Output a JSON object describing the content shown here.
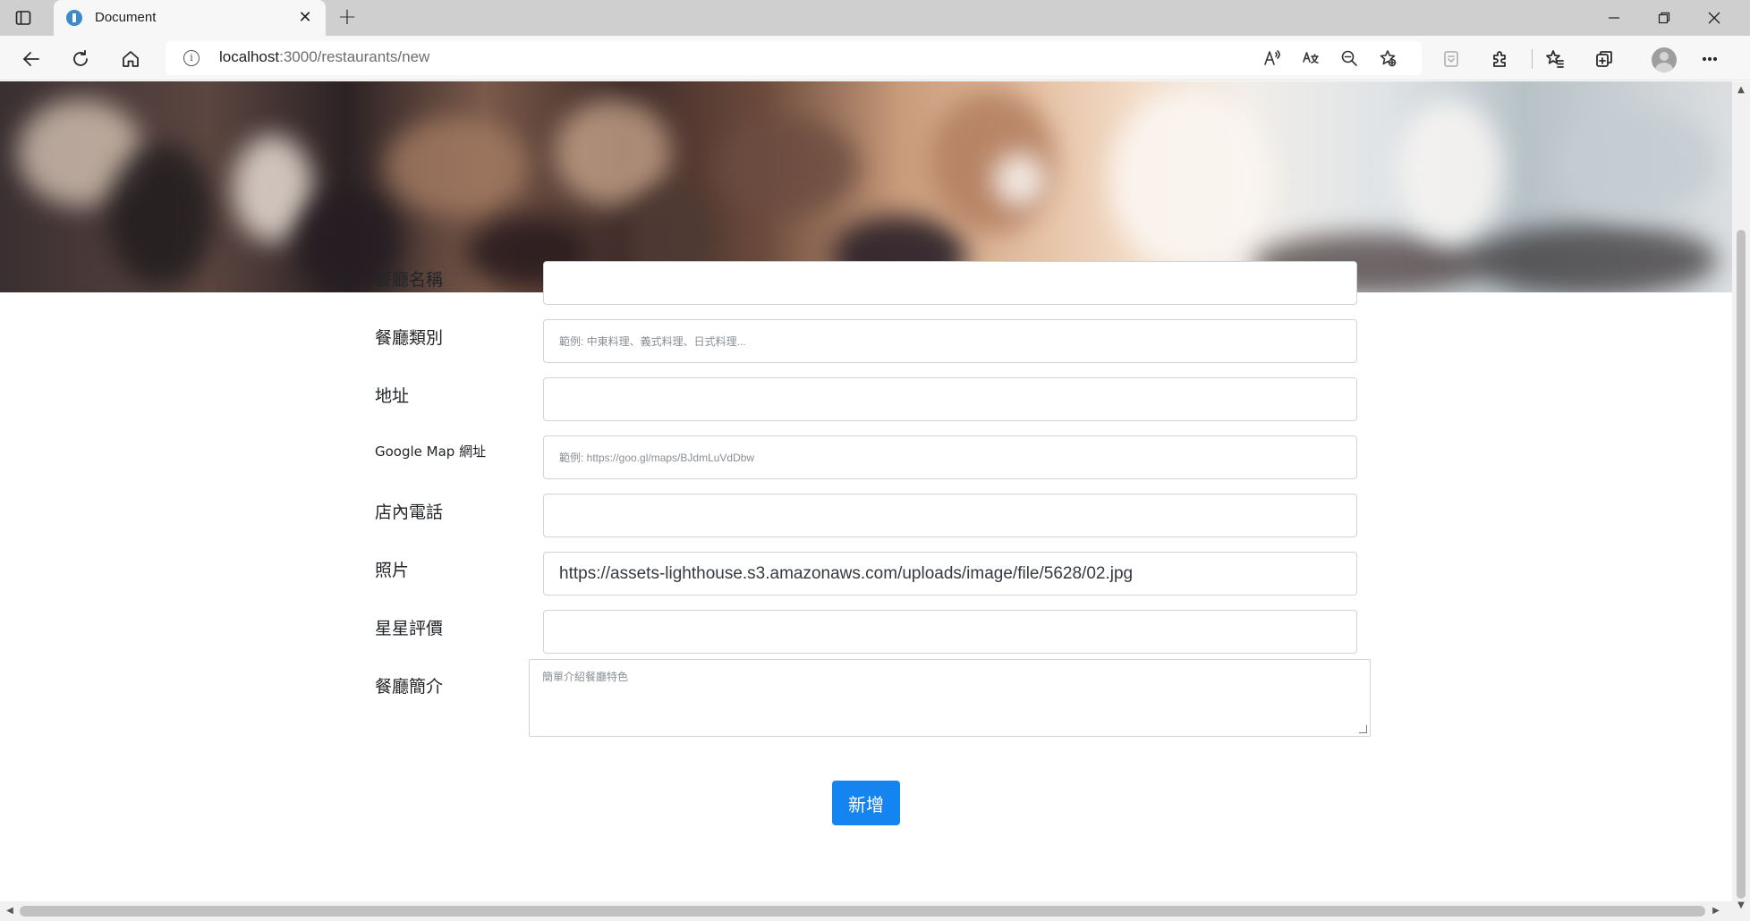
{
  "browser": {
    "tab_title": "Document",
    "url_host": "localhost",
    "url_path": ":3000/restaurants/new",
    "new_tab_symbol": "+",
    "tab_close_symbol": "✕"
  },
  "icons": {
    "sidebar": "tab-actions-icon",
    "back": "back-arrow-icon",
    "refresh": "refresh-icon",
    "home": "home-icon",
    "info": "info-icon",
    "read_aloud": "read-aloud-icon",
    "translate": "translate-icon",
    "zoom": "zoom-out-icon",
    "favorite": "add-favorite-icon",
    "extension": "extensions-icon",
    "favorites": "favorites-icon",
    "collections": "collections-icon",
    "profile": "profile-icon",
    "more": "more-icon"
  },
  "form": {
    "name_label": "餐廳名稱",
    "name_value": "",
    "category_label": "餐廳類別",
    "category_placeholder": "範例: 中東料理、義式料理、日式料理...",
    "address_label": "地址",
    "address_value": "",
    "map_label": "Google Map 網址",
    "map_placeholder": "範例: https://goo.gl/maps/BJdmLuVdDbw",
    "phone_label": "店內電話",
    "phone_value": "",
    "photo_label": "照片",
    "photo_value": "https://assets-lighthouse.s3.amazonaws.com/uploads/image/file/5628/02.jpg",
    "rating_label": "星星評價",
    "rating_value": "",
    "description_label": "餐廳簡介",
    "description_placeholder": "簡單介紹餐廳特色",
    "submit_label": "新增"
  },
  "colors": {
    "primary_button": "#1384f0",
    "input_border": "#ced4da"
  }
}
